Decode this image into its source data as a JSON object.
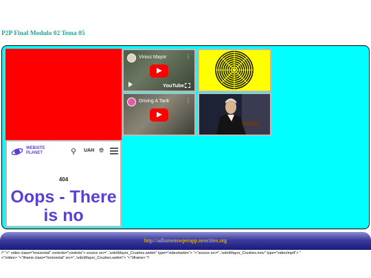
{
  "page": {
    "title": "P2P Final Modulo 02 Tema 05"
  },
  "videos": [
    {
      "title": "Vinius Mayor",
      "platform": "YouTube",
      "more": "⋮"
    },
    {
      "title": "Driving A Tank",
      "more": "⋮"
    }
  ],
  "website_frame": {
    "brand_line1": "WEBSITE",
    "brand_line2": "PLANET",
    "currency": "UAH",
    "error_code": "404",
    "error_message": "Oops - There is no"
  },
  "footer": {
    "url": "http://adlumenswperapp.neocities.org"
  },
  "code_text": {
    "line1": "/* \"<\" video class=\"horizontal\" controls=\"controls\"> source src=\"..\\vdo\\Mayor_Crushes.webm\" type=\"video/webm\"> \"<\"source src=\"..\\vdo\\Mayor_Crushes.mov\" type=\"video/mp4\"> \"",
    "line2": "<\"/video> \"<\"iframe class=\"horizontal\" src=\"..\\vdo\\Mayor_Crushes.webm\"> \"<\"/iframe> */"
  },
  "colors": {
    "title": "#1fa69a",
    "panel_bg": "#00ffff",
    "red_block": "#ff0000",
    "spiral_bg": "#ffff00",
    "brand_purple": "#5b3fd4",
    "footer_link": "#ffd700"
  },
  "icons": [
    "play-icon",
    "search-icon",
    "globe-icon",
    "menu-icon",
    "fullscreen-icon"
  ]
}
